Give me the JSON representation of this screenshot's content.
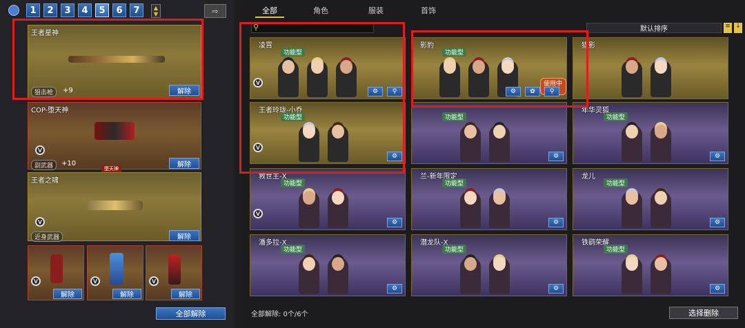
{
  "preset_tabs": [
    "1",
    "2",
    "3",
    "4",
    "5",
    "6",
    "7"
  ],
  "active_preset": "5",
  "weapons": [
    {
      "name": "王者星神",
      "type": "狙击枪",
      "level": "+9",
      "unload": "解除"
    },
    {
      "name": "COP-堕天神",
      "type": "副武器",
      "level": "+10",
      "banner": "堕天神",
      "unload": "解除"
    },
    {
      "name": "王者之啸",
      "type": "近身武器",
      "unload": "解除"
    }
  ],
  "throwables": [
    {
      "unload": "解除"
    },
    {
      "unload": "解除"
    },
    {
      "unload": "解除"
    }
  ],
  "unload_all": "全部解除",
  "tabs": [
    "全部",
    "角色",
    "服装",
    "首饰"
  ],
  "active_tab": "全部",
  "sort_label": "默认排序",
  "characters": [
    {
      "name": "凌霄",
      "type": "功能型",
      "theme": "gold"
    },
    {
      "name": "影豹",
      "type": "功能型",
      "theme": "gold",
      "status": "使用中"
    },
    {
      "name": "猎影",
      "type": "",
      "theme": "gold"
    },
    {
      "name": "王者玲珑-小乔",
      "type": "功能型",
      "theme": "gold"
    },
    {
      "name": "",
      "type": "功能型",
      "theme": "purple"
    },
    {
      "name": "年华灵狐",
      "type": "功能型",
      "theme": "purple"
    },
    {
      "name": "救世主-X",
      "type": "功能型",
      "theme": "purple"
    },
    {
      "name": "兰-新年限定",
      "type": "功能型",
      "theme": "purple"
    },
    {
      "name": "龙儿",
      "type": "功能型",
      "theme": "purple"
    },
    {
      "name": "潘多拉-X",
      "type": "功能型",
      "theme": "purple"
    },
    {
      "name": "潜龙队-X",
      "type": "功能型",
      "theme": "purple"
    },
    {
      "name": "铁鹞荣耀",
      "type": "功能型",
      "theme": "purple"
    }
  ],
  "footer_info": "全部解除: 0个/6个",
  "select_delete": "选择删除"
}
